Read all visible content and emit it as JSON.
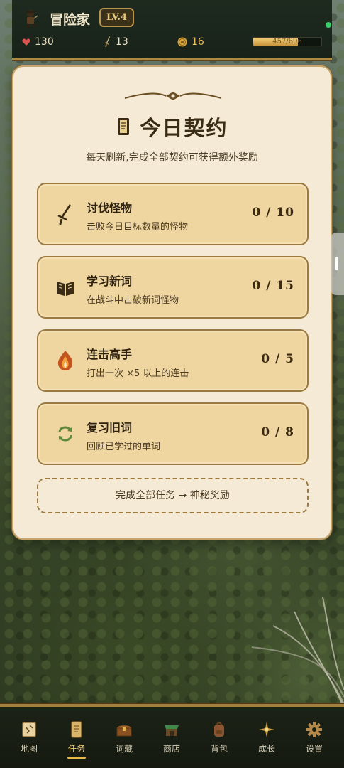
{
  "player": {
    "name": "冒险家",
    "level": "LV.4",
    "hp": "130",
    "attack": "13",
    "coins": "16",
    "xp_text": "457/696",
    "xp_fraction": 0.66
  },
  "panel": {
    "title": "今日契约",
    "subtitle": "每天刷新,完成全部契约可获得额外奖励",
    "tasks": [
      {
        "name": "讨伐怪物",
        "desc": "击败今日目标数量的怪物",
        "progress": "0 / 10",
        "icon": "sword-icon"
      },
      {
        "name": "学习新词",
        "desc": "在战斗中击破新词怪物",
        "progress": "0 / 15",
        "icon": "book-icon"
      },
      {
        "name": "连击高手",
        "desc": "打出一次 ×5 以上的连击",
        "progress": "0 / 5",
        "icon": "flame-icon"
      },
      {
        "name": "复习旧词",
        "desc": "回顾已学过的单词",
        "progress": "0 / 8",
        "icon": "refresh-icon"
      }
    ],
    "reward_hint": "完成全部任务 → 神秘奖励"
  },
  "nav": {
    "items": [
      {
        "label": "地图",
        "icon": "map-icon"
      },
      {
        "label": "任务",
        "icon": "scroll-icon",
        "active": true
      },
      {
        "label": "词藏",
        "icon": "chest-icon"
      },
      {
        "label": "商店",
        "icon": "shop-icon"
      },
      {
        "label": "背包",
        "icon": "backpack-icon"
      },
      {
        "label": "成长",
        "icon": "star-icon"
      },
      {
        "label": "设置",
        "icon": "gear-icon"
      }
    ]
  },
  "colors": {
    "panel_bg": "#f4ead6",
    "task_bg": "#efd6a0",
    "gold_accent": "#b08a3e",
    "active_nav": "#f2d37d",
    "online": "#35d26b"
  }
}
